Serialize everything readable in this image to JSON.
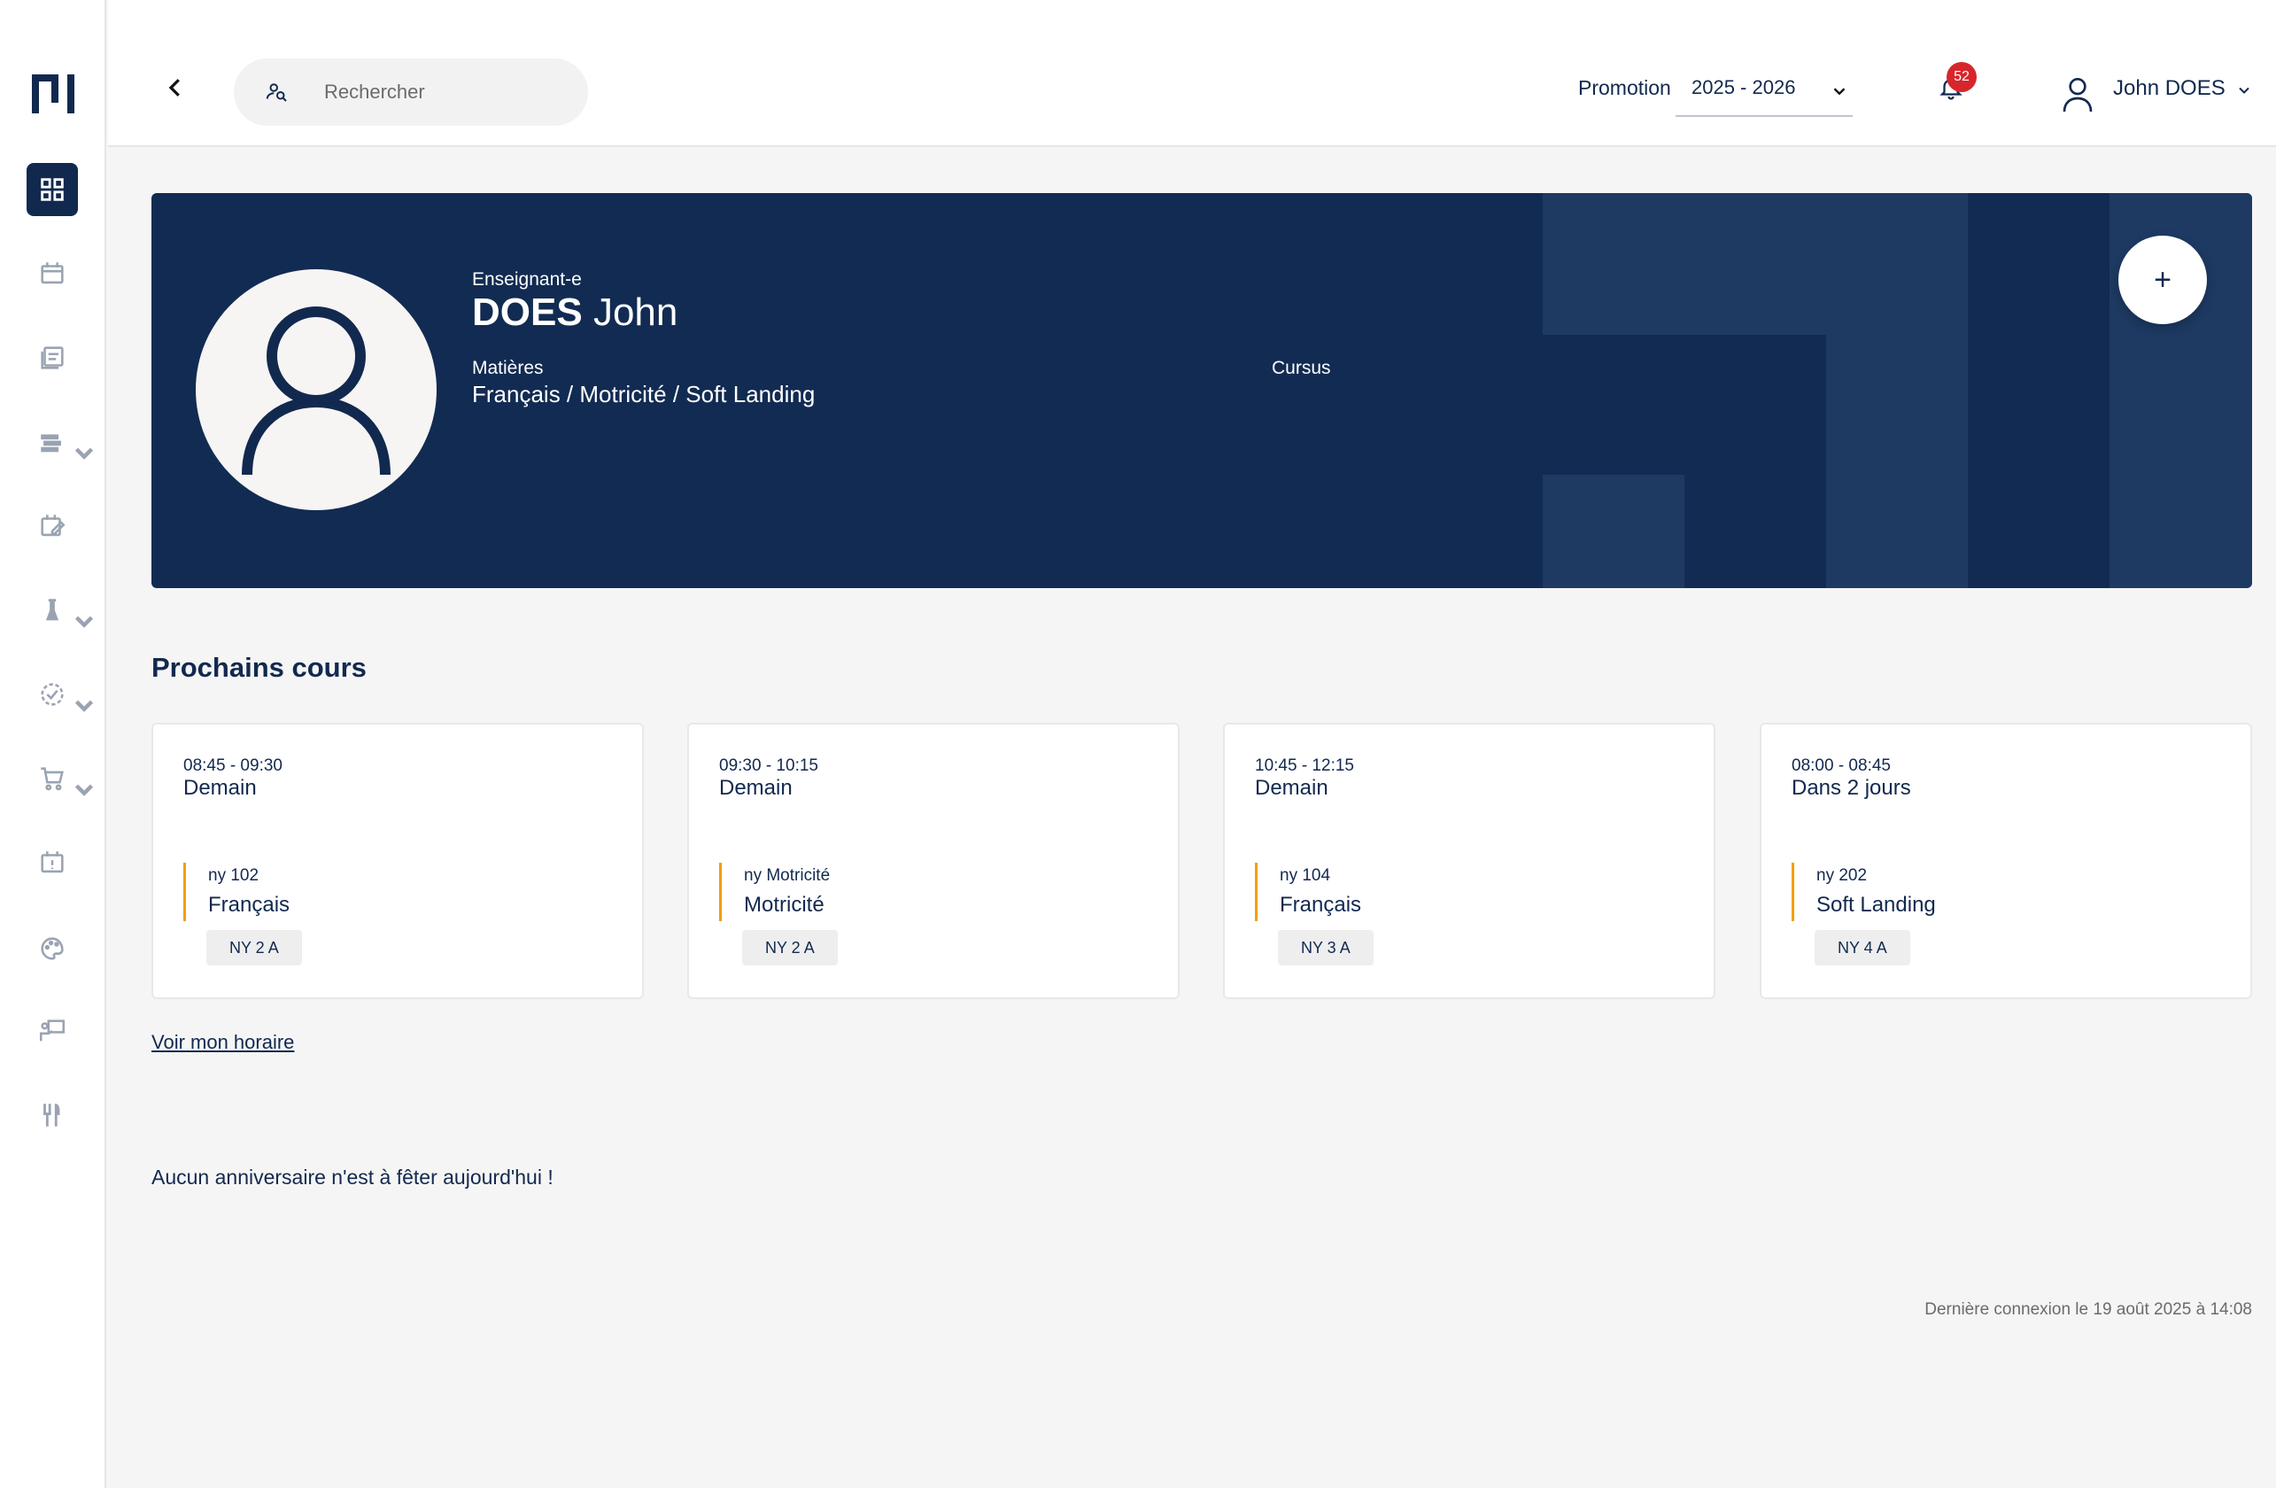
{
  "colors": {
    "primary": "#12294f",
    "banner": "#122b52",
    "accent_bar": "#f0a000",
    "badge": "#d7262b"
  },
  "sidebar": {
    "items": [
      {
        "icon": "dashboard-icon",
        "active": true,
        "has_caret": false
      },
      {
        "icon": "calendar-icon",
        "active": false,
        "has_caret": false
      },
      {
        "icon": "gradebook-icon",
        "active": false,
        "has_caret": false
      },
      {
        "icon": "books-icon",
        "active": false,
        "has_caret": true
      },
      {
        "icon": "calendar-edit-icon",
        "active": false,
        "has_caret": false
      },
      {
        "icon": "flask-icon",
        "active": false,
        "has_caret": true
      },
      {
        "icon": "check-circle-icon",
        "active": false,
        "has_caret": true
      },
      {
        "icon": "cart-icon",
        "active": false,
        "has_caret": true
      },
      {
        "icon": "calendar-alert-icon",
        "active": false,
        "has_caret": false
      },
      {
        "icon": "palette-icon",
        "active": false,
        "has_caret": false
      },
      {
        "icon": "teacher-board-icon",
        "active": false,
        "has_caret": false
      },
      {
        "icon": "restaurant-icon",
        "active": false,
        "has_caret": false
      }
    ]
  },
  "header": {
    "search_placeholder": "Rechercher",
    "promotion_label": "Promotion",
    "promotion_value": "2025 - 2026",
    "notification_count": "52",
    "user_name": "John DOES"
  },
  "profile": {
    "role": "Enseignant-e",
    "last_name": "DOES",
    "first_name": "John",
    "subjects_label": "Matières",
    "subjects_value": "Français / Motricité / Soft Landing",
    "cursus_label": "Cursus",
    "add_label": "+"
  },
  "courses": {
    "title": "Prochains cours",
    "items": [
      {
        "time": "08:45 - 09:30",
        "when": "Demain",
        "room": "ny 102",
        "subject": "Français",
        "class": "NY 2 A"
      },
      {
        "time": "09:30 - 10:15",
        "when": "Demain",
        "room": "ny Motricité",
        "subject": "Motricité",
        "class": "NY 2 A"
      },
      {
        "time": "10:45 - 12:15",
        "when": "Demain",
        "room": "ny 104",
        "subject": "Français",
        "class": "NY 3 A"
      },
      {
        "time": "08:00 - 08:45",
        "when": "Dans 2 jours",
        "room": "ny 202",
        "subject": "Soft Landing",
        "class": "NY 4 A"
      }
    ],
    "schedule_link": "Voir mon horaire"
  },
  "birthday_text": "Aucun anniversaire n'est à fêter aujourd'hui !",
  "last_login": "Dernière connexion le 19 août 2025 à 14:08"
}
